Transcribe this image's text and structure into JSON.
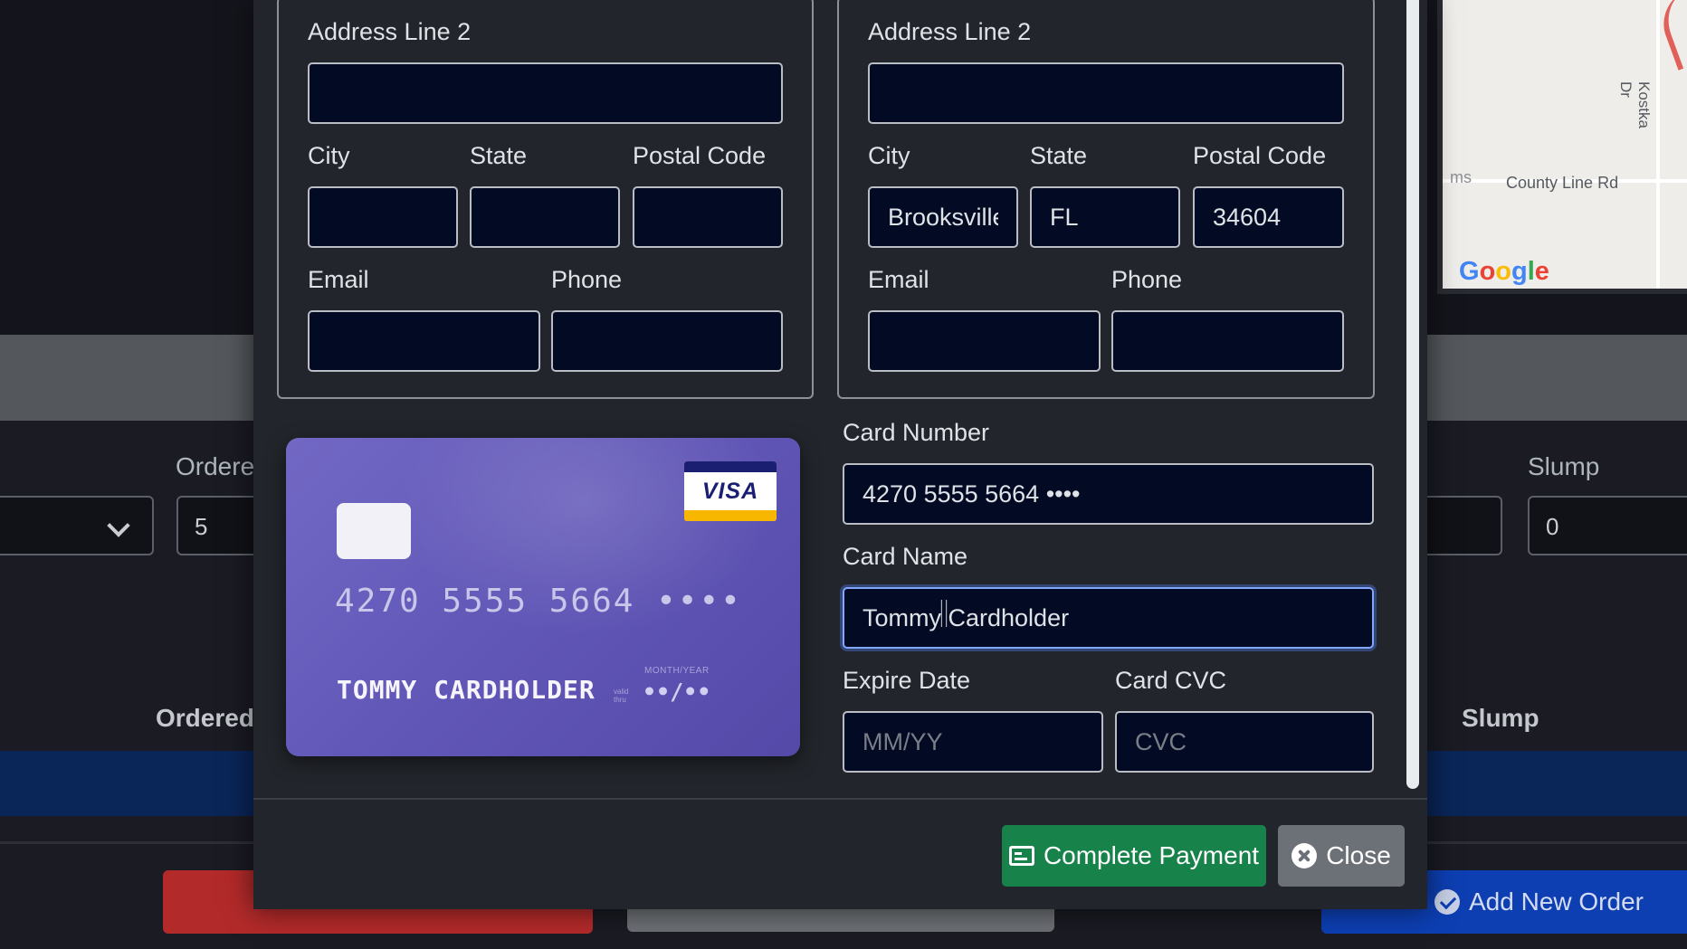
{
  "background": {
    "ordered_label_top": "Ordere",
    "ordered_value": "5",
    "slump_label_top": "Slump",
    "slump_value": "0",
    "ordered_header": "Ordered",
    "slump_header": "Slump",
    "add_new_order_label": "Add New Order",
    "map": {
      "road_label": "County Line Rd",
      "side_label": "ms",
      "vertical_label": "Kostka Dr",
      "logo": [
        "G",
        "o",
        "o",
        "g",
        "l",
        "e"
      ]
    }
  },
  "billing": {
    "address_line2_label": "Address Line 2",
    "address_line2_value": "",
    "city_label": "City",
    "city_value": "",
    "state_label": "State",
    "state_value": "",
    "postal_label": "Postal Code",
    "postal_value": "",
    "email_label": "Email",
    "email_value": "",
    "phone_label": "Phone",
    "phone_value": ""
  },
  "shipping": {
    "address_line2_label": "Address Line 2",
    "address_line2_value": "",
    "city_label": "City",
    "city_value": "Brooksville",
    "state_label": "State",
    "state_value": "FL",
    "postal_label": "Postal Code",
    "postal_value": "34604",
    "email_label": "Email",
    "email_value": "",
    "phone_label": "Phone",
    "phone_value": ""
  },
  "card_preview": {
    "brand": "VISA",
    "number": "4270 5555 5664 ••••",
    "name": "TOMMY CARDHOLDER",
    "valid_text": "valid thru",
    "expiry_caption": "MONTH/YEAR",
    "expiry": "••/••"
  },
  "payment_form": {
    "card_number_label": "Card Number",
    "card_number_value": "4270 5555 5664 ••••",
    "card_name_label": "Card Name",
    "card_name_value": "Tommy Cardholder",
    "expire_label": "Expire Date",
    "expire_placeholder": "MM/YY",
    "cvc_label": "Card CVC",
    "cvc_placeholder": "CVC"
  },
  "footer": {
    "complete_payment_label": "Complete Payment",
    "close_label": "Close"
  },
  "colors": {
    "modal_bg": "#22252b",
    "input_bg": "#030a24",
    "pay_button": "#17824a",
    "close_button": "#6c7178",
    "card_gradient_start": "#7268c4",
    "card_gradient_end": "#5549a8"
  }
}
